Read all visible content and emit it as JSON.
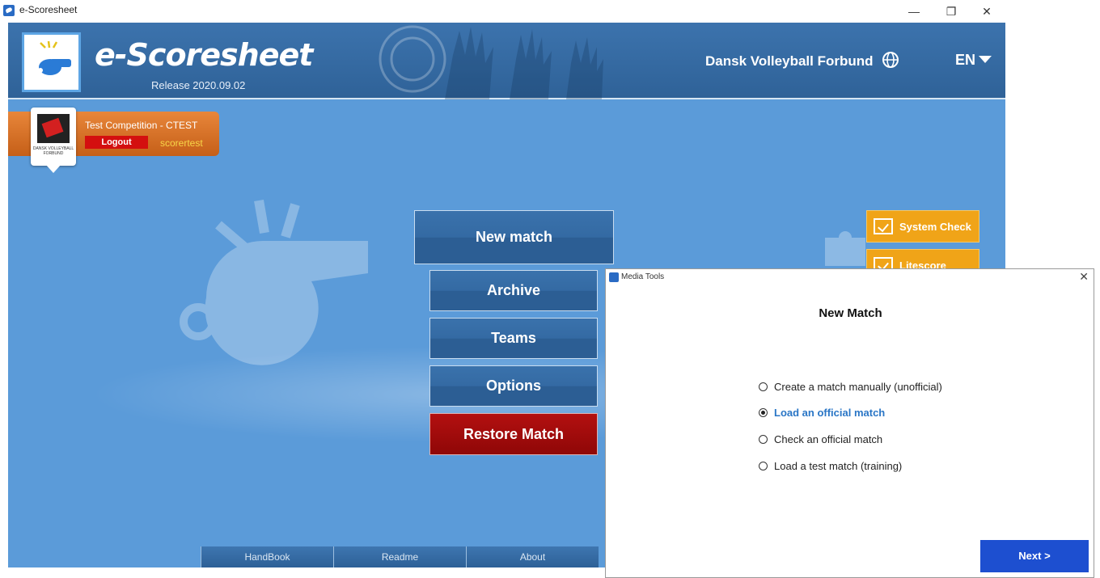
{
  "window": {
    "title": "e-Scoresheet",
    "minimize": "—",
    "maximize": "❐",
    "close": "✕"
  },
  "header": {
    "brand": "e-Scoresheet",
    "release": "Release 2020.09.02",
    "federation": "Dansk Volleyball Forbund",
    "language": "EN",
    "icons": [
      "whistle-logo-icon",
      "globe-icon",
      "chevron-down-icon"
    ]
  },
  "competition": {
    "name": "Test Competition - CTEST",
    "logout_label": "Logout",
    "user": "scorertest",
    "badge_text": "DANSK VOLLEYBALL FORBUND"
  },
  "menu": {
    "new_match": "New match",
    "archive": "Archive",
    "teams": "Teams",
    "options": "Options",
    "restore": "Restore Match"
  },
  "checks": {
    "system": "System Check",
    "litescore": "Litescore Check"
  },
  "footer": {
    "tabs": [
      "HandBook",
      "Readme",
      "About"
    ]
  },
  "dialog": {
    "window_title": "Media Tools",
    "close": "✕",
    "heading": "New Match",
    "options": [
      {
        "label": "Create a match manually (unofficial)",
        "selected": false
      },
      {
        "label": "Load an official match",
        "selected": true
      },
      {
        "label": "Check an official match",
        "selected": false
      },
      {
        "label": "Load a test match (training)",
        "selected": false
      }
    ],
    "next_label": "Next >"
  },
  "colors": {
    "app_bg": "#5b9bd9",
    "header_bg": "#2f6298",
    "accent_orange": "#f0a418",
    "restore_red": "#a00c0c",
    "next_blue": "#1d4fd0",
    "selected_text": "#2a76c6"
  }
}
